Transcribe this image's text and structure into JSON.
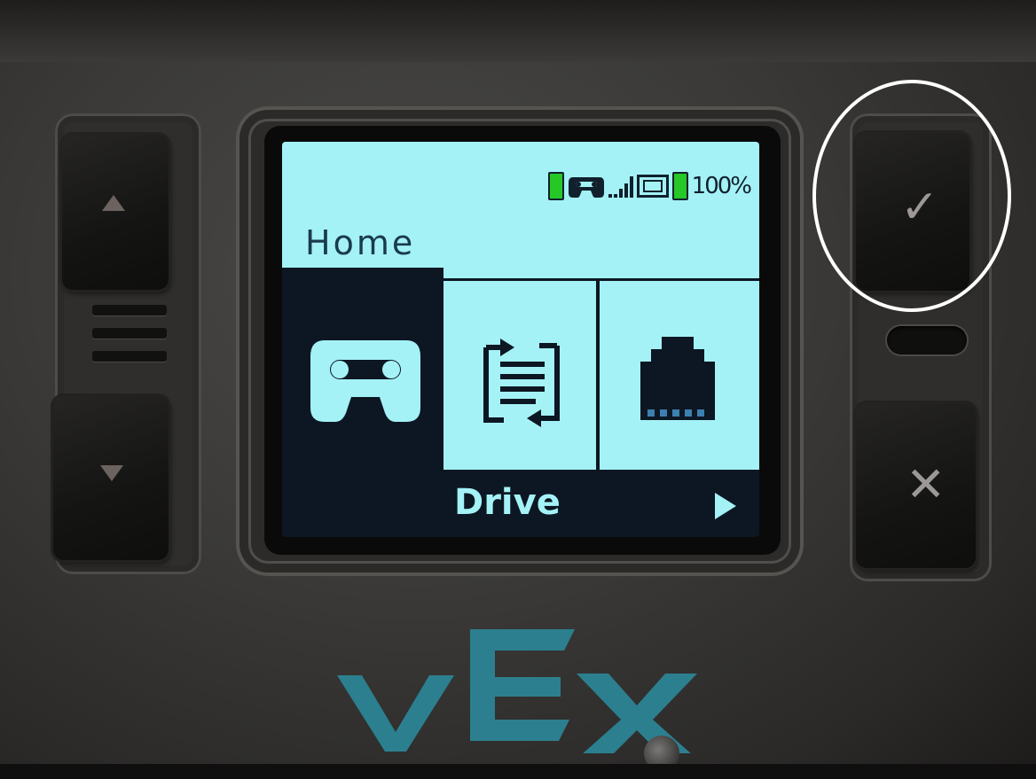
{
  "device": {
    "brand_logo": "VEX",
    "status_bar": {
      "controller_battery_icon": "battery-icon",
      "controller_icon": "controller-icon",
      "signal_icon": "signal-bars-icon",
      "radio_icon": "radio-icon",
      "brain_battery_icon": "battery-icon",
      "battery_percent": "100%"
    },
    "screen": {
      "title": "Home",
      "tabs": [
        {
          "icon": "controller-icon",
          "selected": true
        },
        {
          "icon": "program-transfer-icon",
          "selected": false
        },
        {
          "icon": "port-icon",
          "selected": false
        }
      ],
      "selected_label": "Drive",
      "next_indicator": "right-arrow-icon"
    },
    "buttons": {
      "left_up": "up-arrow-icon",
      "left_down": "down-arrow-icon",
      "confirm": "checkmark-icon",
      "cancel": "x-icon"
    },
    "highlight": "confirm-button",
    "colors": {
      "screen_bg": "#0c1723",
      "screen_light": "#a4f2f6",
      "battery_green": "#25c827",
      "logo_teal": "#2c7f8f",
      "highlight_ring": "#ffffff"
    }
  }
}
